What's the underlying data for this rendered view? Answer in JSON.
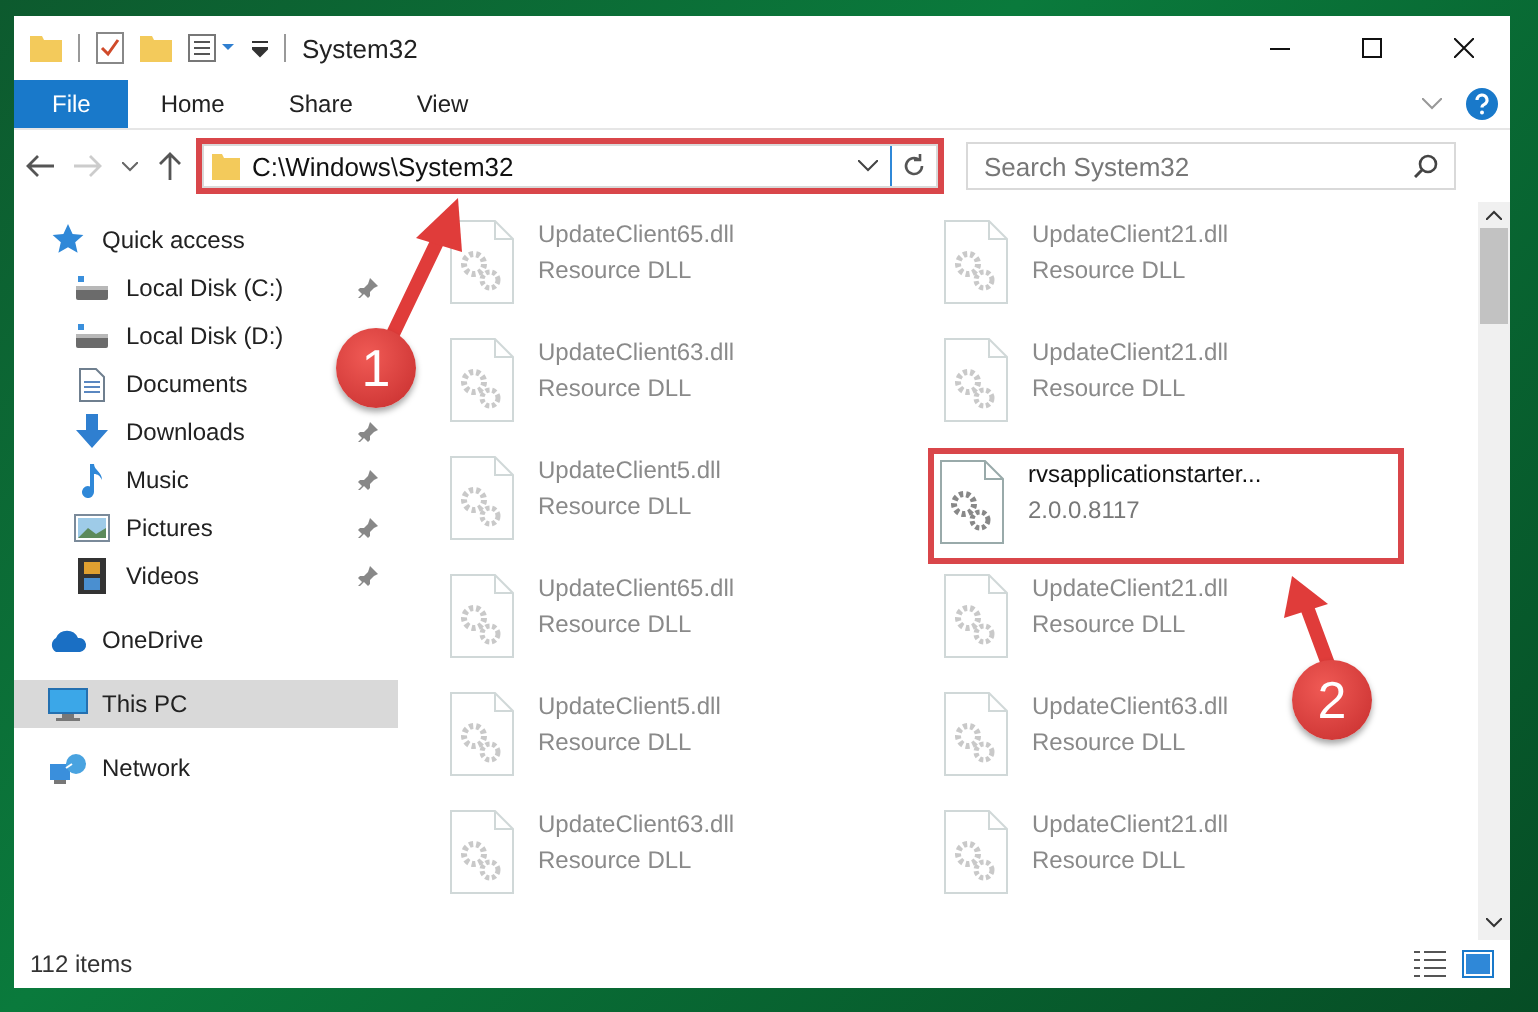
{
  "window": {
    "title": "System32"
  },
  "ribbon_tabs": [
    {
      "label": "File",
      "selected": true
    },
    {
      "label": "Home",
      "selected": false
    },
    {
      "label": "Share",
      "selected": false
    },
    {
      "label": "View",
      "selected": false
    }
  ],
  "address_bar": {
    "value": "C:\\Windows\\System32",
    "highlighted": true
  },
  "search": {
    "placeholder": "Search System32"
  },
  "sidebar": {
    "items": [
      {
        "label": "Quick access",
        "selected": false,
        "children": [
          {
            "label": "Local Disk (C:)",
            "pinned": true,
            "selected": false
          },
          {
            "label": "Local Disk (D:)",
            "pinned": false,
            "selected": false
          },
          {
            "label": "Documents",
            "pinned": false,
            "selected": false
          },
          {
            "label": "Downloads",
            "pinned": true,
            "selected": false
          },
          {
            "label": "Music",
            "pinned": true,
            "selected": false
          },
          {
            "label": "Pictures",
            "pinned": true,
            "selected": false
          },
          {
            "label": "Videos",
            "pinned": true,
            "selected": false
          }
        ]
      },
      {
        "label": "OneDrive",
        "selected": false
      },
      {
        "label": "This PC",
        "selected": true
      },
      {
        "label": "Network",
        "selected": false
      }
    ]
  },
  "files": [
    {
      "name": "UpdateClient65.dll",
      "detail": "Resource DLL",
      "faded": true,
      "highlighted": false
    },
    {
      "name": "UpdateClient21.dll",
      "detail": "Resource DLL",
      "faded": true,
      "highlighted": false
    },
    {
      "name": "UpdateClient63.dll",
      "detail": "Resource DLL",
      "faded": true,
      "highlighted": false
    },
    {
      "name": "UpdateClient21.dll",
      "detail": "Resource DLL",
      "faded": true,
      "highlighted": false
    },
    {
      "name": "UpdateClient5.dll",
      "detail": "Resource DLL",
      "faded": true,
      "highlighted": false
    },
    {
      "name": "rvsapplicationstarter...",
      "detail": "2.0.0.8117",
      "faded": false,
      "highlighted": true
    },
    {
      "name": "UpdateClient65.dll",
      "detail": "Resource DLL",
      "faded": true,
      "highlighted": false
    },
    {
      "name": "UpdateClient21.dll",
      "detail": "Resource DLL",
      "faded": true,
      "highlighted": false
    },
    {
      "name": "UpdateClient5.dll",
      "detail": "Resource DLL",
      "faded": true,
      "highlighted": false
    },
    {
      "name": "UpdateClient63.dll",
      "detail": "Resource DLL",
      "faded": true,
      "highlighted": false
    },
    {
      "name": "UpdateClient63.dll",
      "detail": "Resource DLL",
      "faded": true,
      "highlighted": false
    },
    {
      "name": "UpdateClient21.dll",
      "detail": "Resource DLL",
      "faded": true,
      "highlighted": false
    }
  ],
  "status_bar": {
    "item_count": "112 items"
  },
  "annotations": [
    {
      "label": "1"
    },
    {
      "label": "2"
    }
  ]
}
